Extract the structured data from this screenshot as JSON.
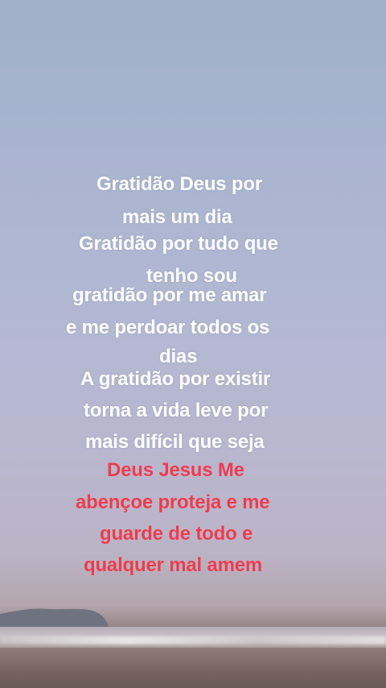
{
  "text_lines": [
    {
      "text": "Gratidão Deus por",
      "color": "#ffffff"
    },
    {
      "text": "mais um dia",
      "color": "#ffffff"
    },
    {
      "text": "Gratidão por tudo que",
      "color": "#ffffff"
    },
    {
      "text": "tenho sou",
      "color": "#ffffff"
    },
    {
      "text": "gratidão por me amar",
      "color": "#ffffff"
    },
    {
      "text": "e me perdoar todos os",
      "color": "#ffffff"
    },
    {
      "text": "dias",
      "color": "#ffffff"
    },
    {
      "text": "A gratidão por existir",
      "color": "#ffffff"
    },
    {
      "text": "torna a vida leve por",
      "color": "#ffffff"
    },
    {
      "text": "mais difícil que seja",
      "color": "#ffffff"
    },
    {
      "text": "Deus Jesus Me",
      "color": "#ee3b4d"
    },
    {
      "text": "abençoe proteja e me",
      "color": "#ee3b4d"
    },
    {
      "text": "guarde de todo e",
      "color": "#ee3b4d"
    },
    {
      "text": "qualquer mal amem",
      "color": "#ee3b4d"
    }
  ],
  "colors": {
    "text_white": "#ffffff",
    "text_red": "#ee3b4d"
  }
}
